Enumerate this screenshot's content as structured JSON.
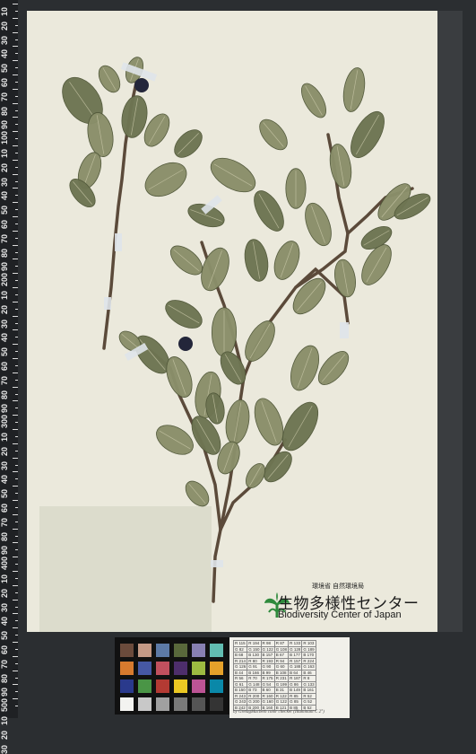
{
  "ruler": {
    "labels": [
      "10",
      "20",
      "30",
      "40",
      "50",
      "60",
      "70",
      "80",
      "90",
      "100",
      "10",
      "20",
      "30",
      "40",
      "50",
      "60",
      "70",
      "80",
      "90",
      "200",
      "10",
      "20",
      "30",
      "40",
      "50",
      "60",
      "70",
      "80",
      "90",
      "300",
      "10",
      "20",
      "30",
      "40",
      "50",
      "60",
      "70",
      "80",
      "90",
      "400",
      "10",
      "20",
      "30",
      "40",
      "50",
      "60",
      "70",
      "80",
      "90",
      "500",
      "10",
      "20",
      "30"
    ]
  },
  "logo": {
    "org": "環境省 自然環境局",
    "name_jp": "生物多様性センター",
    "name_en": "Biodiversity Center of Japan"
  },
  "colors": {
    "background": "#2b2e31",
    "sheet": "#ebe9dc",
    "leaf": "#8a8f6a",
    "leaf_dark": "#6e7552",
    "stem": "#5b4a3a",
    "logo_green": "#2e8a3c"
  },
  "checker": {
    "rows": [
      [
        "#6b4b3c",
        "#c49a86",
        "#5d7aa6",
        "#59683b",
        "#8880b2",
        "#62bdb1"
      ],
      [
        "#d77a2e",
        "#4658a4",
        "#c1505e",
        "#4d2e6b",
        "#9dbb41",
        "#e5a12a"
      ],
      [
        "#2a3a8c",
        "#4a9546",
        "#b33a33",
        "#ebc823",
        "#bd5495",
        "#0a88a8"
      ],
      [
        "#f3f3f0",
        "#c8c8c8",
        "#a0a0a0",
        "#7a7a79",
        "#555555",
        "#343434"
      ]
    ]
  },
  "reference": {
    "rows": [
      [
        "R 115",
        "R 194",
        "R 98",
        "R 87",
        "R 133",
        "R 103"
      ],
      [
        "G 82",
        "G 150",
        "G 122",
        "G 108",
        "G 128",
        "G 189"
      ],
      [
        "B 68",
        "B 130",
        "B 157",
        "B 67",
        "B 177",
        "B 170"
      ],
      [
        "R 214",
        "R 80",
        "R 193",
        "R 94",
        "R 157",
        "R 224"
      ],
      [
        "G 126",
        "G 91",
        "G 90",
        "G 60",
        "G 188",
        "G 163"
      ],
      [
        "B 44",
        "B 166",
        "B 99",
        "B 108",
        "B 64",
        "B 46"
      ],
      [
        "R 56",
        "R 70",
        "R 175",
        "R 231",
        "R 187",
        "R 8"
      ],
      [
        "G 61",
        "G 148",
        "G 54",
        "G 199",
        "G 86",
        "G 133"
      ],
      [
        "B 150",
        "B 73",
        "B 60",
        "B 31",
        "B 149",
        "B 161"
      ],
      [
        "R 243",
        "R 200",
        "R 160",
        "R 122",
        "R 85",
        "R 52"
      ],
      [
        "G 243",
        "G 200",
        "G 160",
        "G 122",
        "G 85",
        "G 52"
      ],
      [
        "B 242",
        "B 200",
        "B 160",
        "B 121",
        "B 85",
        "B 52"
      ]
    ],
    "caption": "by GretagMacbeth color checker (Illuminant C 2°)"
  }
}
